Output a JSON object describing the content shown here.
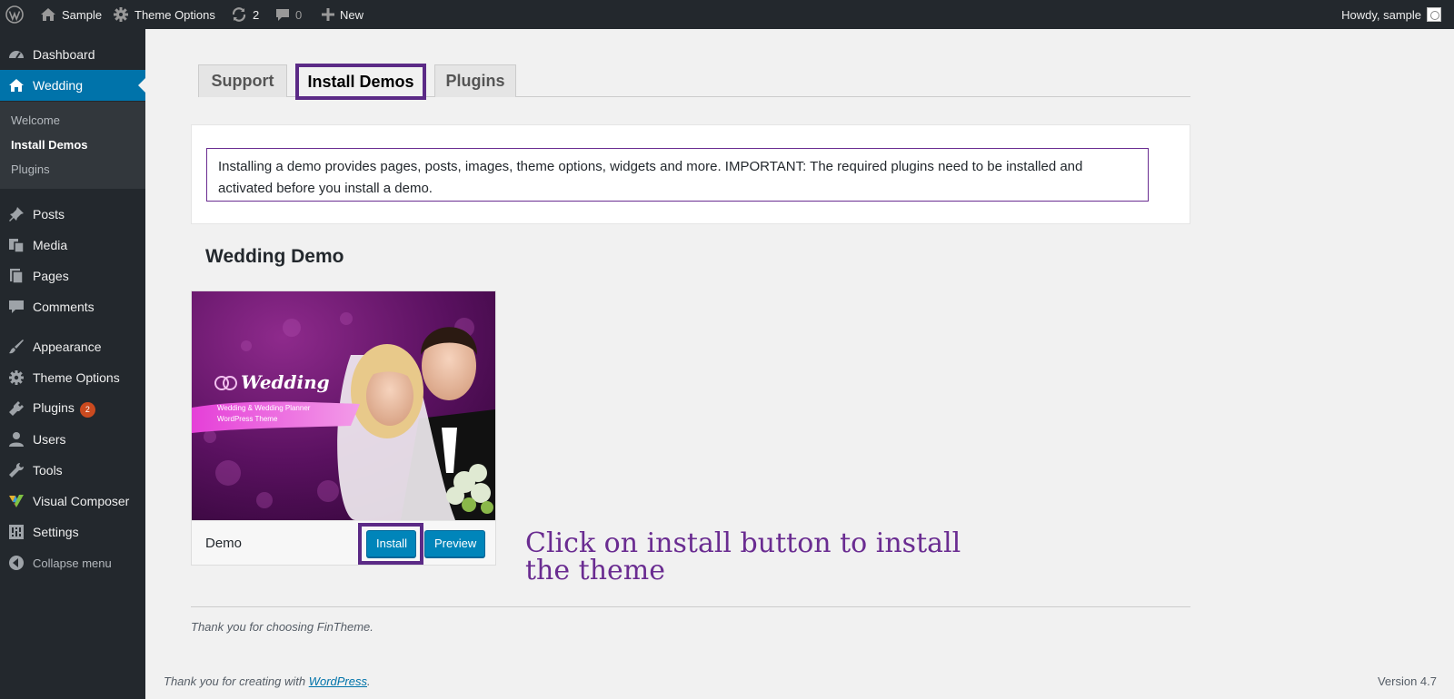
{
  "adminbar": {
    "site_name": "Sample",
    "theme_options": "Theme Options",
    "updates_count": "2",
    "comments_count": "0",
    "new_label": "New",
    "howdy": "Howdy, sample"
  },
  "sidebar": {
    "items": [
      {
        "label": "Dashboard",
        "icon": "dashboard-icon"
      },
      {
        "label": "Wedding",
        "icon": "home-icon"
      },
      {
        "label": "Posts",
        "icon": "pin-icon"
      },
      {
        "label": "Media",
        "icon": "media-icon"
      },
      {
        "label": "Pages",
        "icon": "pages-icon"
      },
      {
        "label": "Comments",
        "icon": "comment-icon"
      },
      {
        "label": "Appearance",
        "icon": "brush-icon"
      },
      {
        "label": "Theme Options",
        "icon": "gear-icon"
      },
      {
        "label": "Plugins",
        "icon": "plug-icon",
        "badge": "2"
      },
      {
        "label": "Users",
        "icon": "user-icon"
      },
      {
        "label": "Tools",
        "icon": "wrench-icon"
      },
      {
        "label": "Visual Composer",
        "icon": "visual-composer-icon"
      },
      {
        "label": "Settings",
        "icon": "settings-icon"
      },
      {
        "label": "Collapse menu",
        "icon": "collapse-icon"
      }
    ],
    "submenu": [
      "Welcome",
      "Install Demos",
      "Plugins"
    ],
    "current_submenu": "Install Demos"
  },
  "tabs": [
    "Support",
    "Install Demos",
    "Plugins"
  ],
  "active_tab": "Install Demos",
  "notice": "Installing a demo provides pages, posts, images, theme options, widgets and more. IMPORTANT: The required plugins need to be installed and activated before you install a demo.",
  "demo": {
    "heading": "Wedding Demo",
    "name": "Demo",
    "install_label": "Install",
    "preview_label": "Preview",
    "thumb_title": "Wedding",
    "thumb_sub1": "Wedding & Wedding Planner",
    "thumb_sub2": "WordPress Theme"
  },
  "callout": {
    "line1": "Click on install button to install",
    "line2": "the theme"
  },
  "thanks": "Thank you for choosing FinTheme.",
  "footer": {
    "prefix": "Thank you for creating with ",
    "link": "WordPress",
    "suffix": ".",
    "version": "Version 4.7"
  },
  "colors": {
    "adminbar": "#23282d",
    "accent": "#0073aa",
    "highlight": "#5b2a86",
    "callout": "#6a2c91"
  }
}
